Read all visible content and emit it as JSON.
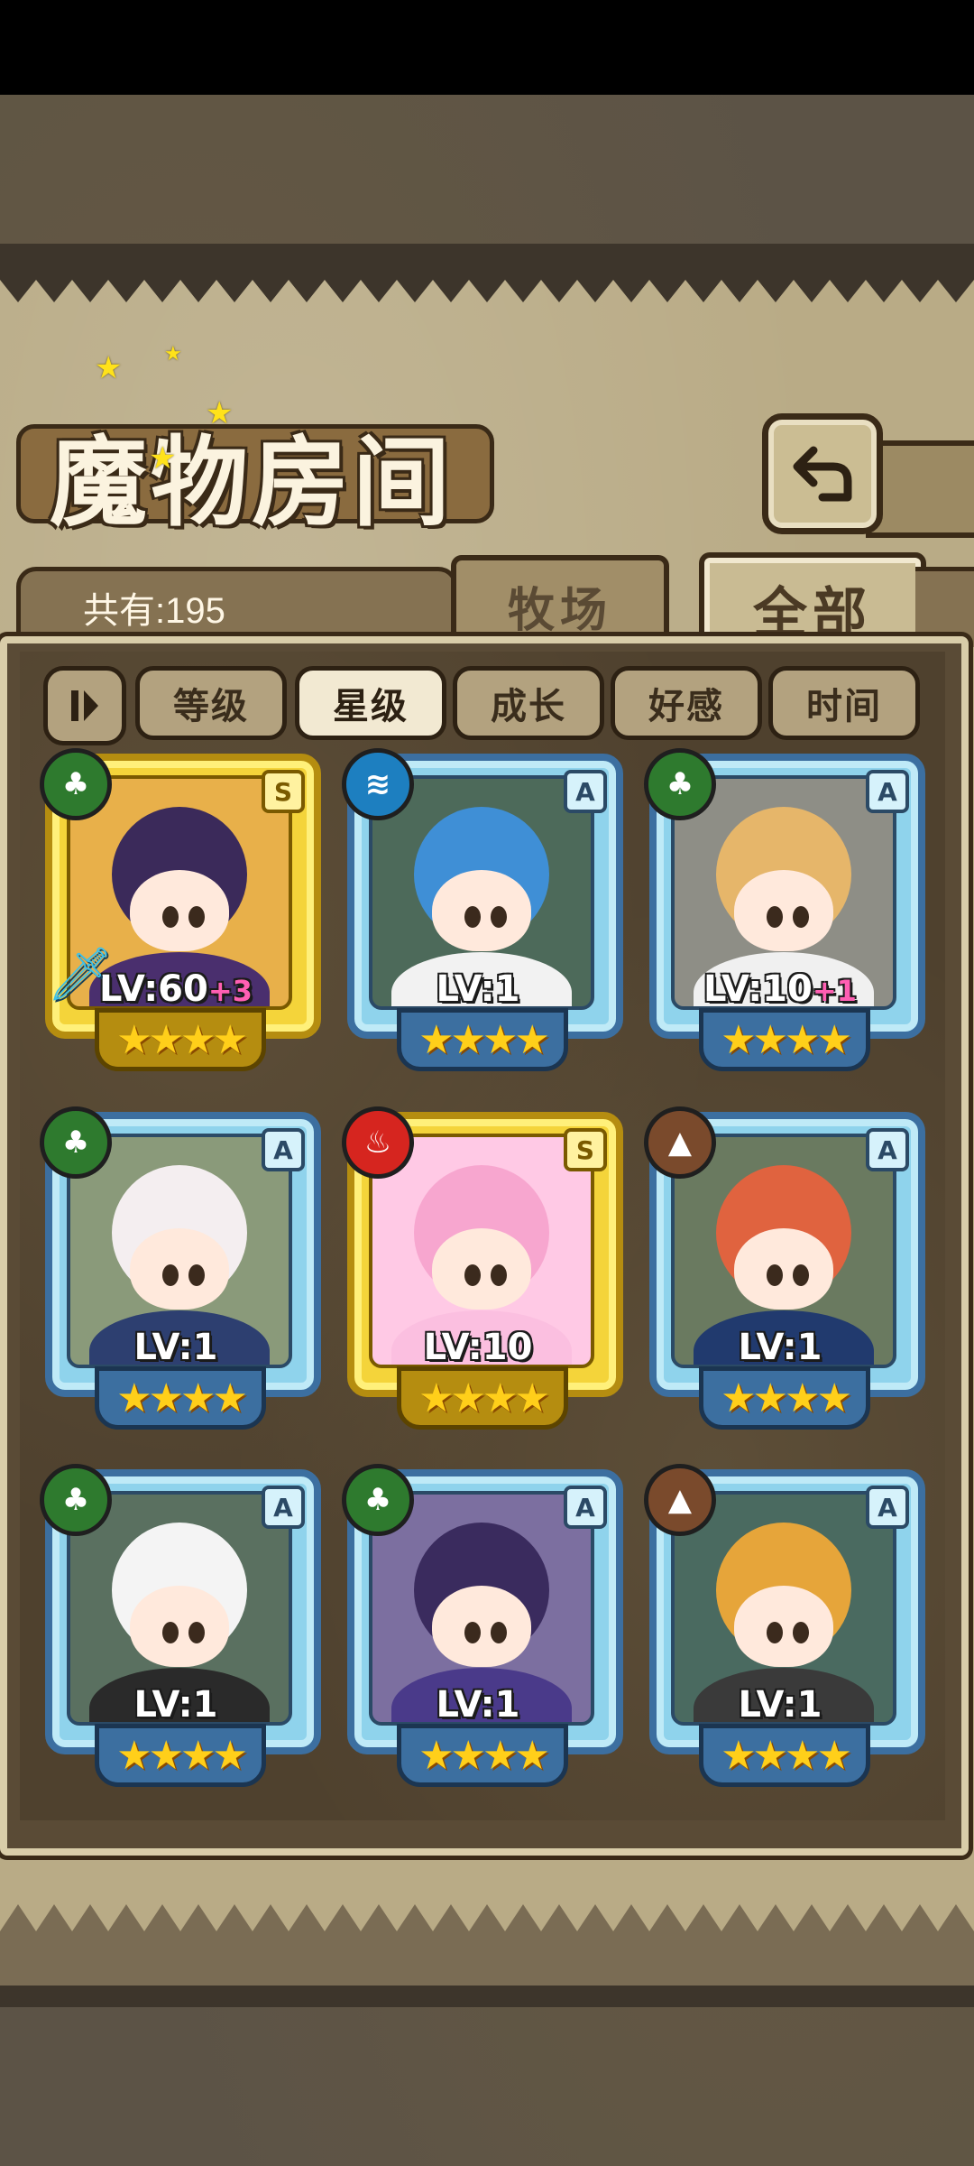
{
  "header": {
    "title": "魔物房间"
  },
  "toolbar": {
    "back_icon": "return-arrow-icon",
    "count_label": "共有:195"
  },
  "tabs": [
    {
      "label": "牧场",
      "active": false
    },
    {
      "label": "全部",
      "active": true
    }
  ],
  "filters": {
    "sort_icon": "sort-toggle-icon",
    "items": [
      {
        "label": "等级",
        "active": false
      },
      {
        "label": "星级",
        "active": true
      },
      {
        "label": "成长",
        "active": false
      },
      {
        "label": "好感",
        "active": false
      },
      {
        "label": "时间",
        "active": false
      }
    ]
  },
  "monsters": [
    {
      "level": "LV:60",
      "bonus": "+3",
      "rank": "S",
      "element": "grass",
      "stars": "★★★★",
      "gold": true,
      "weapon": true
    },
    {
      "level": "LV:1",
      "bonus": "",
      "rank": "A",
      "element": "water",
      "stars": "★★★★",
      "gold": false,
      "weapon": false
    },
    {
      "level": "LV:10",
      "bonus": "+1",
      "rank": "A",
      "element": "grass",
      "stars": "★★★★",
      "gold": false,
      "weapon": false
    },
    {
      "level": "LV:1",
      "bonus": "",
      "rank": "A",
      "element": "grass",
      "stars": "★★★★",
      "gold": false,
      "weapon": false
    },
    {
      "level": "LV:10",
      "bonus": "",
      "rank": "S",
      "element": "fire",
      "stars": "★★★★",
      "gold": true,
      "weapon": false
    },
    {
      "level": "LV:1",
      "bonus": "",
      "rank": "A",
      "element": "earth",
      "stars": "★★★★",
      "gold": false,
      "weapon": false
    },
    {
      "level": "LV:1",
      "bonus": "",
      "rank": "A",
      "element": "grass",
      "stars": "★★★★",
      "gold": false,
      "weapon": false
    },
    {
      "level": "LV:1",
      "bonus": "",
      "rank": "A",
      "element": "grass",
      "stars": "★★★★",
      "gold": false,
      "weapon": false
    },
    {
      "level": "LV:1",
      "bonus": "",
      "rank": "A",
      "element": "earth",
      "stars": "★★★★",
      "gold": false,
      "weapon": false
    }
  ],
  "colors": {
    "parchment": "#b9ab86",
    "panel": "#4f412e",
    "blue_frame": "#8fd3ec",
    "gold_frame": "#f4d43a"
  }
}
